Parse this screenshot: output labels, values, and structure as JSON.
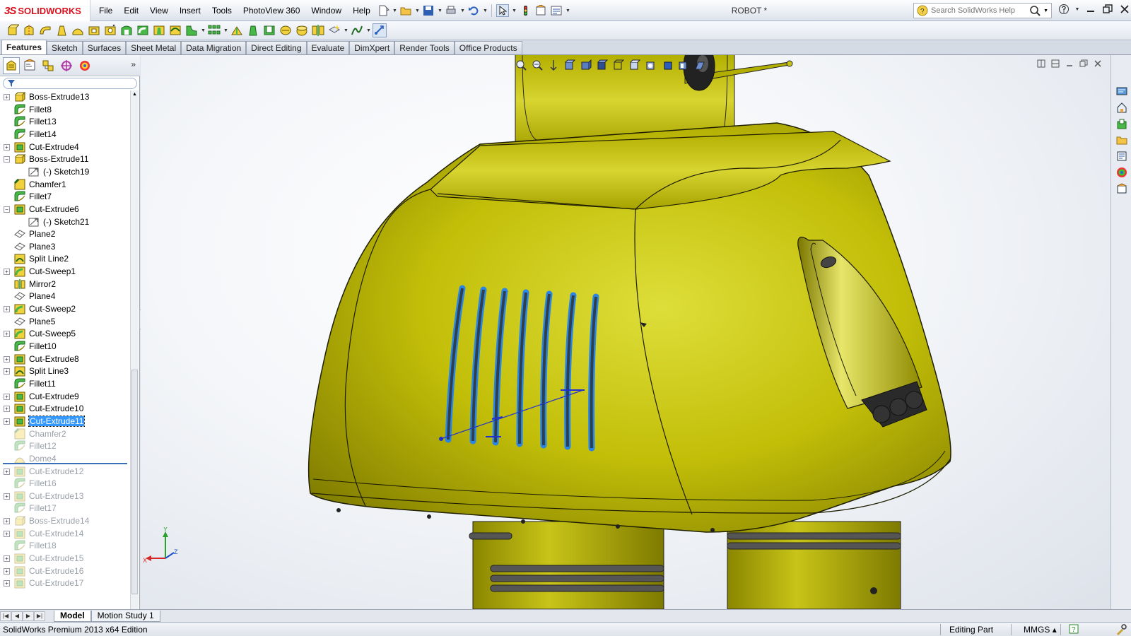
{
  "app": {
    "logo_ds": "3S",
    "logo_name": "SOLIDWORKS",
    "document_title": "ROBOT *"
  },
  "menu": [
    "File",
    "Edit",
    "View",
    "Insert",
    "Tools",
    "PhotoView 360",
    "Window",
    "Help"
  ],
  "search": {
    "placeholder": "Search SolidWorks Help"
  },
  "command_tabs": [
    "Features",
    "Sketch",
    "Surfaces",
    "Sheet Metal",
    "Data Migration",
    "Direct Editing",
    "Evaluate",
    "DimXpert",
    "Render Tools",
    "Office Products"
  ],
  "active_command_tab": "Features",
  "feature_tree": [
    {
      "label": "Boss-Extrude13",
      "icon": "boss-extrude-icon",
      "expandable": true,
      "expanded": false,
      "indent": 0,
      "suppressed": false
    },
    {
      "label": "Fillet8",
      "icon": "fillet-icon",
      "expandable": false,
      "indent": 0,
      "suppressed": false
    },
    {
      "label": "Fillet13",
      "icon": "fillet-icon",
      "expandable": false,
      "indent": 0,
      "suppressed": false
    },
    {
      "label": "Fillet14",
      "icon": "fillet-icon",
      "expandable": false,
      "indent": 0,
      "suppressed": false
    },
    {
      "label": "Cut-Extrude4",
      "icon": "cut-extrude-icon",
      "expandable": true,
      "expanded": false,
      "indent": 0,
      "suppressed": false
    },
    {
      "label": "Boss-Extrude11",
      "icon": "boss-extrude-icon",
      "expandable": true,
      "expanded": true,
      "indent": 0,
      "suppressed": false
    },
    {
      "label": "(-) Sketch19",
      "icon": "sketch-icon",
      "expandable": false,
      "indent": 1,
      "suppressed": false
    },
    {
      "label": "Chamfer1",
      "icon": "chamfer-icon",
      "expandable": false,
      "indent": 0,
      "suppressed": false
    },
    {
      "label": "Fillet7",
      "icon": "fillet-icon",
      "expandable": false,
      "indent": 0,
      "suppressed": false
    },
    {
      "label": "Cut-Extrude6",
      "icon": "cut-extrude-icon",
      "expandable": true,
      "expanded": true,
      "indent": 0,
      "suppressed": false
    },
    {
      "label": "(-) Sketch21",
      "icon": "sketch-icon",
      "expandable": false,
      "indent": 1,
      "suppressed": false
    },
    {
      "label": "Plane2",
      "icon": "plane-icon",
      "expandable": false,
      "indent": 0,
      "suppressed": false
    },
    {
      "label": "Plane3",
      "icon": "plane-icon",
      "expandable": false,
      "indent": 0,
      "suppressed": false
    },
    {
      "label": "Split Line2",
      "icon": "split-line-icon",
      "expandable": false,
      "indent": 0,
      "suppressed": false
    },
    {
      "label": "Cut-Sweep1",
      "icon": "cut-sweep-icon",
      "expandable": true,
      "expanded": false,
      "indent": 0,
      "suppressed": false
    },
    {
      "label": "Mirror2",
      "icon": "mirror-icon",
      "expandable": false,
      "indent": 0,
      "suppressed": false
    },
    {
      "label": "Plane4",
      "icon": "plane-icon",
      "expandable": false,
      "indent": 0,
      "suppressed": false
    },
    {
      "label": "Cut-Sweep2",
      "icon": "cut-sweep-icon",
      "expandable": true,
      "expanded": false,
      "indent": 0,
      "suppressed": false
    },
    {
      "label": "Plane5",
      "icon": "plane-icon",
      "expandable": false,
      "indent": 0,
      "suppressed": false
    },
    {
      "label": "Cut-Sweep5",
      "icon": "cut-sweep-icon",
      "expandable": true,
      "expanded": false,
      "indent": 0,
      "suppressed": false
    },
    {
      "label": "Fillet10",
      "icon": "fillet-icon",
      "expandable": false,
      "indent": 0,
      "suppressed": false
    },
    {
      "label": "Cut-Extrude8",
      "icon": "cut-extrude-icon",
      "expandable": true,
      "expanded": false,
      "indent": 0,
      "suppressed": false
    },
    {
      "label": "Split Line3",
      "icon": "split-line-icon",
      "expandable": true,
      "expanded": false,
      "indent": 0,
      "suppressed": false
    },
    {
      "label": "Fillet11",
      "icon": "fillet-icon",
      "expandable": false,
      "indent": 0,
      "suppressed": false
    },
    {
      "label": "Cut-Extrude9",
      "icon": "cut-extrude-icon",
      "expandable": true,
      "expanded": false,
      "indent": 0,
      "suppressed": false
    },
    {
      "label": "Cut-Extrude10",
      "icon": "cut-extrude-icon",
      "expandable": true,
      "expanded": false,
      "indent": 0,
      "suppressed": false
    },
    {
      "label": "Cut-Extrude11",
      "icon": "cut-extrude-icon",
      "expandable": true,
      "expanded": false,
      "indent": 0,
      "suppressed": false,
      "selected": true
    },
    {
      "label": "Chamfer2",
      "icon": "chamfer-icon",
      "expandable": false,
      "indent": 0,
      "suppressed": true
    },
    {
      "label": "Fillet12",
      "icon": "fillet-icon",
      "expandable": false,
      "indent": 0,
      "suppressed": true
    },
    {
      "label": "Dome4",
      "icon": "dome-icon",
      "expandable": false,
      "indent": 0,
      "suppressed": true
    },
    {
      "label": "Cut-Extrude12",
      "icon": "cut-extrude-icon",
      "expandable": true,
      "expanded": false,
      "indent": 0,
      "suppressed": true
    },
    {
      "label": "Fillet16",
      "icon": "fillet-icon",
      "expandable": false,
      "indent": 0,
      "suppressed": true
    },
    {
      "label": "Cut-Extrude13",
      "icon": "cut-extrude-icon",
      "expandable": true,
      "expanded": false,
      "indent": 0,
      "suppressed": true
    },
    {
      "label": "Fillet17",
      "icon": "fillet-icon",
      "expandable": false,
      "indent": 0,
      "suppressed": true
    },
    {
      "label": "Boss-Extrude14",
      "icon": "boss-extrude-icon",
      "expandable": true,
      "expanded": false,
      "indent": 0,
      "suppressed": true
    },
    {
      "label": "Cut-Extrude14",
      "icon": "cut-extrude-icon",
      "expandable": true,
      "expanded": false,
      "indent": 0,
      "suppressed": true
    },
    {
      "label": "Fillet18",
      "icon": "fillet-icon",
      "expandable": false,
      "indent": 0,
      "suppressed": true
    },
    {
      "label": "Cut-Extrude15",
      "icon": "cut-extrude-icon",
      "expandable": true,
      "expanded": false,
      "indent": 0,
      "suppressed": true
    },
    {
      "label": "Cut-Extrude16",
      "icon": "cut-extrude-icon",
      "expandable": true,
      "expanded": false,
      "indent": 0,
      "suppressed": true
    },
    {
      "label": "Cut-Extrude17",
      "icon": "cut-extrude-icon",
      "expandable": true,
      "expanded": false,
      "indent": 0,
      "suppressed": true
    }
  ],
  "bottom_tabs": [
    "Model",
    "Motion Study 1"
  ],
  "active_bottom_tab": "Model",
  "status": {
    "text": "SolidWorks Premium 2013 x64 Edition",
    "mode": "Editing Part",
    "units": "MMGS",
    "units_arrow": "▴"
  },
  "triad": {
    "x": "X",
    "y": "Y",
    "z": "Z"
  },
  "colors": {
    "model_body": "#b8b400",
    "model_highlight": "#e8e86a",
    "model_shadow": "#6a6800",
    "selection_blue": "#3399ff",
    "edge": "#1e1e00"
  },
  "icons": {
    "pm_tabs": [
      "featuremanager-icon",
      "propertymanager-icon",
      "configurationmanager-icon",
      "dimxpert-icon",
      "display-manager-icon"
    ],
    "task_pane": [
      "solidworks-resources-icon",
      "design-library-icon",
      "file-explorer-icon",
      "view-palette-icon",
      "appearances-icon",
      "custom-properties-icon",
      "forum-icon"
    ]
  }
}
